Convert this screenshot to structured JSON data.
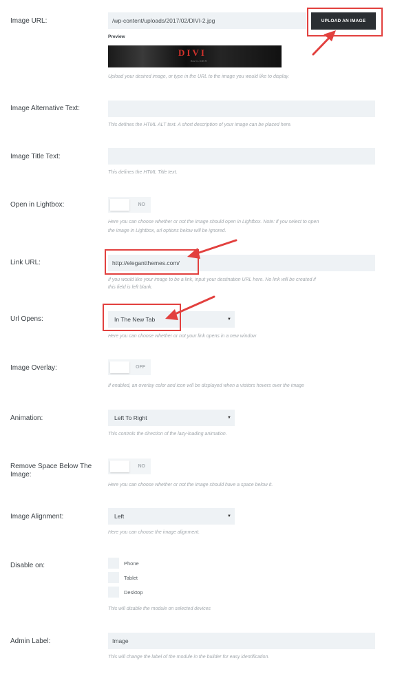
{
  "image_url": {
    "label": "Image URL:",
    "value": "/wp-content/uploads/2017/02/DIVI-2.jpg",
    "upload_button": "UPLOAD AN IMAGE",
    "preview_label": "Preview",
    "preview_text": "DIVI",
    "preview_subtext": "BUILDER",
    "description": "Upload your desired image, or type in the URL to the image you would like to display."
  },
  "alt_text": {
    "label": "Image Alternative Text:",
    "value": "",
    "description": "This defines the HTML ALT text. A short description of your image can be placed here."
  },
  "title_text": {
    "label": "Image Title Text:",
    "value": "",
    "description": "This defines the HTML Title text."
  },
  "lightbox": {
    "label": "Open in Lightbox:",
    "state": "NO",
    "description_line1": "Here you can choose whether or not the image should open in Lightbox. Note: if you select to open",
    "description_line2": "the image in Lightbox, url options below will be ignored."
  },
  "link_url": {
    "label": "Link URL:",
    "value": "http://elegantthemes.com/",
    "description_line1": "If you would like your image to be a link, input your destination URL here. No link will be created if",
    "description_line2": "this field is left blank."
  },
  "url_opens": {
    "label": "Url Opens:",
    "value": "In The New Tab",
    "description": "Here you can choose whether or not your link opens in a new window"
  },
  "overlay": {
    "label": "Image Overlay:",
    "state": "OFF",
    "description": "If enabled, an overlay color and icon will be displayed when a visitors hovers over the image"
  },
  "animation": {
    "label": "Animation:",
    "value": "Left To Right",
    "description": "This controls the direction of the lazy-loading animation."
  },
  "remove_space": {
    "label_line1": "Remove Space Below The",
    "label_line2": "Image:",
    "state": "NO",
    "description": "Here you can choose whether or not the image should have a space below it."
  },
  "alignment": {
    "label": "Image Alignment:",
    "value": "Left",
    "description": "Here you can choose the image alignment."
  },
  "disable_on": {
    "label": "Disable on:",
    "options": [
      "Phone",
      "Tablet",
      "Desktop"
    ],
    "description": "This will disable the module on selected devices"
  },
  "admin_label": {
    "label": "Admin Label:",
    "value": "Image",
    "description": "This will change the label of the module in the builder for easy identification."
  },
  "colors": {
    "highlight": "#e2403e",
    "button_bg": "#2b2f33",
    "field_bg": "#eef2f5"
  }
}
